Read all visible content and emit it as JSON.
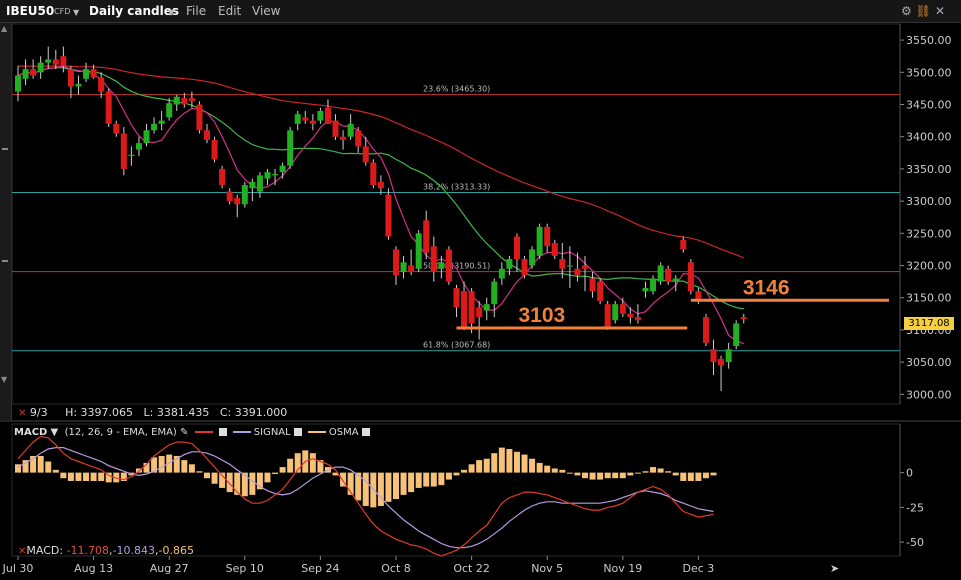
{
  "toolbar": {
    "symbol": "IBEU50",
    "instrument_type": "CFD",
    "period": "Daily candles",
    "menu_file": "File",
    "menu_edit": "Edit",
    "menu_view": "View"
  },
  "info_bar": {
    "date": "9/3",
    "high": "H: 3397.065",
    "low": "L: 3381.435",
    "close": "C: 3391.000"
  },
  "current_price": "3117.08",
  "annotations": {
    "support_level": "3103",
    "resistance_level": "3146"
  },
  "macd_legend": {
    "name": "MACD",
    "params": "(12, 26, 9 - EMA, EMA)",
    "signal": "SIGNAL",
    "osma": "OSMA"
  },
  "macd_values": {
    "label": "MACD:",
    "macd": "-11.708",
    "signal": "-10.843",
    "osma": "-0.865"
  },
  "colors": {
    "bull": "#22b022",
    "bear": "#dd1a1a",
    "ma_short": "#d0308a",
    "ma_mid": "#3cb84a",
    "ma_long": "#c8262a",
    "fib_line": "#2aa3a3",
    "fib_edge": "#c0362c",
    "annotation": "#f2803a",
    "macd_line": "#e03a2a",
    "signal_line": "#b69de0",
    "osma": "#f6c27a"
  },
  "chart_data": [
    {
      "type": "candlestick",
      "ylim": [
        2985,
        3575
      ],
      "y_ticks": [
        3000,
        3050,
        3100,
        3150,
        3200,
        3250,
        3300,
        3350,
        3400,
        3450,
        3500,
        3550
      ],
      "y_tick_labels": [
        "3000.00",
        "3050.00",
        "3100.00",
        "3150.00",
        "3200.00",
        "3250.00",
        "3300.00",
        "3350.00",
        "3400.00",
        "3450.00",
        "3500.00",
        "3550.00"
      ],
      "x_tick_labels": [
        "Jul 30",
        "Aug 13",
        "Aug 27",
        "Sep 10",
        "Sep 24",
        "Oct 8",
        "Oct 22",
        "Nov 5",
        "Nov 19",
        "Dec 3"
      ],
      "x_tick_index": [
        0,
        10,
        20,
        30,
        40,
        50,
        60,
        70,
        80,
        90
      ],
      "fib_levels": [
        {
          "label": "23.6% (3465.30)",
          "value": 3465.3
        },
        {
          "label": "38.2% (3313.33)",
          "value": 3313.33
        },
        {
          "label": "50.0% (3190.51)",
          "value": 3190.51
        },
        {
          "label": "61.8% (3067.68)",
          "value": 3067.68
        }
      ],
      "support": {
        "value": 3103,
        "from_index": 58,
        "to_index": 88
      },
      "resistance": {
        "value": 3146,
        "from_index": 89,
        "to_index": 103
      },
      "candles": [
        {
          "o": 3470,
          "h": 3510,
          "l": 3455,
          "c": 3495
        },
        {
          "o": 3490,
          "h": 3520,
          "l": 3480,
          "c": 3505
        },
        {
          "o": 3505,
          "h": 3520,
          "l": 3490,
          "c": 3495
        },
        {
          "o": 3500,
          "h": 3525,
          "l": 3490,
          "c": 3515
        },
        {
          "o": 3515,
          "h": 3540,
          "l": 3505,
          "c": 3520
        },
        {
          "o": 3520,
          "h": 3535,
          "l": 3505,
          "c": 3512
        },
        {
          "o": 3525,
          "h": 3540,
          "l": 3500,
          "c": 3510
        },
        {
          "o": 3505,
          "h": 3510,
          "l": 3460,
          "c": 3478
        },
        {
          "o": 3478,
          "h": 3495,
          "l": 3465,
          "c": 3482
        },
        {
          "o": 3490,
          "h": 3515,
          "l": 3485,
          "c": 3505
        },
        {
          "o": 3505,
          "h": 3512,
          "l": 3490,
          "c": 3492
        },
        {
          "o": 3492,
          "h": 3500,
          "l": 3460,
          "c": 3470
        },
        {
          "o": 3470,
          "h": 3475,
          "l": 3415,
          "c": 3420
        },
        {
          "o": 3420,
          "h": 3425,
          "l": 3400,
          "c": 3405
        },
        {
          "o": 3405,
          "h": 3415,
          "l": 3340,
          "c": 3350
        },
        {
          "o": 3370,
          "h": 3385,
          "l": 3355,
          "c": 3372
        },
        {
          "o": 3380,
          "h": 3400,
          "l": 3370,
          "c": 3390
        },
        {
          "o": 3390,
          "h": 3420,
          "l": 3385,
          "c": 3410
        },
        {
          "o": 3410,
          "h": 3430,
          "l": 3405,
          "c": 3420
        },
        {
          "o": 3420,
          "h": 3440,
          "l": 3410,
          "c": 3425
        },
        {
          "o": 3430,
          "h": 3460,
          "l": 3425,
          "c": 3452
        },
        {
          "o": 3450,
          "h": 3465,
          "l": 3440,
          "c": 3462
        },
        {
          "o": 3460,
          "h": 3468,
          "l": 3445,
          "c": 3450
        },
        {
          "o": 3460,
          "h": 3470,
          "l": 3445,
          "c": 3455
        },
        {
          "o": 3450,
          "h": 3455,
          "l": 3405,
          "c": 3410
        },
        {
          "o": 3410,
          "h": 3420,
          "l": 3390,
          "c": 3395
        },
        {
          "o": 3395,
          "h": 3400,
          "l": 3360,
          "c": 3365
        },
        {
          "o": 3350,
          "h": 3355,
          "l": 3320,
          "c": 3325
        },
        {
          "o": 3315,
          "h": 3320,
          "l": 3295,
          "c": 3300
        },
        {
          "o": 3305,
          "h": 3310,
          "l": 3275,
          "c": 3295
        },
        {
          "o": 3295,
          "h": 3330,
          "l": 3290,
          "c": 3325
        },
        {
          "o": 3320,
          "h": 3335,
          "l": 3300,
          "c": 3330
        },
        {
          "o": 3315,
          "h": 3345,
          "l": 3305,
          "c": 3340
        },
        {
          "o": 3335,
          "h": 3350,
          "l": 3325,
          "c": 3345
        },
        {
          "o": 3340,
          "h": 3350,
          "l": 3325,
          "c": 3342
        },
        {
          "o": 3345,
          "h": 3360,
          "l": 3335,
          "c": 3355
        },
        {
          "o": 3355,
          "h": 3415,
          "l": 3350,
          "c": 3410
        },
        {
          "o": 3420,
          "h": 3440,
          "l": 3410,
          "c": 3435
        },
        {
          "o": 3430,
          "h": 3440,
          "l": 3420,
          "c": 3425
        },
        {
          "o": 3425,
          "h": 3435,
          "l": 3410,
          "c": 3420
        },
        {
          "o": 3425,
          "h": 3445,
          "l": 3420,
          "c": 3440
        },
        {
          "o": 3445,
          "h": 3458,
          "l": 3420,
          "c": 3420
        },
        {
          "o": 3425,
          "h": 3435,
          "l": 3395,
          "c": 3400
        },
        {
          "o": 3400,
          "h": 3410,
          "l": 3380,
          "c": 3395
        },
        {
          "o": 3400,
          "h": 3435,
          "l": 3395,
          "c": 3420
        },
        {
          "o": 3410,
          "h": 3415,
          "l": 3375,
          "c": 3385
        },
        {
          "o": 3385,
          "h": 3400,
          "l": 3355,
          "c": 3360
        },
        {
          "o": 3360,
          "h": 3365,
          "l": 3320,
          "c": 3325
        },
        {
          "o": 3330,
          "h": 3340,
          "l": 3310,
          "c": 3320
        },
        {
          "o": 3310,
          "h": 3320,
          "l": 3240,
          "c": 3245
        },
        {
          "o": 3225,
          "h": 3230,
          "l": 3170,
          "c": 3185
        },
        {
          "o": 3190,
          "h": 3215,
          "l": 3180,
          "c": 3205
        },
        {
          "o": 3200,
          "h": 3225,
          "l": 3185,
          "c": 3190
        },
        {
          "o": 3195,
          "h": 3255,
          "l": 3190,
          "c": 3250
        },
        {
          "o": 3270,
          "h": 3285,
          "l": 3210,
          "c": 3220
        },
        {
          "o": 3230,
          "h": 3245,
          "l": 3175,
          "c": 3190
        },
        {
          "o": 3195,
          "h": 3215,
          "l": 3180,
          "c": 3205
        },
        {
          "o": 3225,
          "h": 3230,
          "l": 3170,
          "c": 3175
        },
        {
          "o": 3165,
          "h": 3170,
          "l": 3120,
          "c": 3135
        },
        {
          "o": 3160,
          "h": 3175,
          "l": 3100,
          "c": 3105
        },
        {
          "o": 3160,
          "h": 3165,
          "l": 3095,
          "c": 3110
        },
        {
          "o": 3135,
          "h": 3145,
          "l": 3085,
          "c": 3120
        },
        {
          "o": 3130,
          "h": 3150,
          "l": 3115,
          "c": 3140
        },
        {
          "o": 3140,
          "h": 3180,
          "l": 3120,
          "c": 3175
        },
        {
          "o": 3180,
          "h": 3205,
          "l": 3170,
          "c": 3195
        },
        {
          "o": 3195,
          "h": 3215,
          "l": 3185,
          "c": 3210
        },
        {
          "o": 3245,
          "h": 3250,
          "l": 3190,
          "c": 3210
        },
        {
          "o": 3210,
          "h": 3215,
          "l": 3180,
          "c": 3185
        },
        {
          "o": 3200,
          "h": 3230,
          "l": 3195,
          "c": 3225
        },
        {
          "o": 3215,
          "h": 3265,
          "l": 3210,
          "c": 3260
        },
        {
          "o": 3260,
          "h": 3265,
          "l": 3220,
          "c": 3230
        },
        {
          "o": 3235,
          "h": 3240,
          "l": 3210,
          "c": 3215
        },
        {
          "o": 3210,
          "h": 3235,
          "l": 3180,
          "c": 3195
        },
        {
          "o": 3200,
          "h": 3230,
          "l": 3165,
          "c": 3200
        },
        {
          "o": 3195,
          "h": 3220,
          "l": 3175,
          "c": 3185
        },
        {
          "o": 3200,
          "h": 3215,
          "l": 3160,
          "c": 3195
        },
        {
          "o": 3180,
          "h": 3190,
          "l": 3150,
          "c": 3160
        },
        {
          "o": 3175,
          "h": 3180,
          "l": 3140,
          "c": 3145
        },
        {
          "o": 3140,
          "h": 3145,
          "l": 3100,
          "c": 3105
        },
        {
          "o": 3115,
          "h": 3145,
          "l": 3110,
          "c": 3140
        },
        {
          "o": 3140,
          "h": 3150,
          "l": 3120,
          "c": 3125
        },
        {
          "o": 3125,
          "h": 3135,
          "l": 3110,
          "c": 3120
        },
        {
          "o": 3120,
          "h": 3140,
          "l": 3110,
          "c": 3115
        },
        {
          "o": 3160,
          "h": 3175,
          "l": 3150,
          "c": 3165
        },
        {
          "o": 3160,
          "h": 3185,
          "l": 3155,
          "c": 3180
        },
        {
          "o": 3175,
          "h": 3205,
          "l": 3170,
          "c": 3200
        },
        {
          "o": 3195,
          "h": 3200,
          "l": 3170,
          "c": 3175
        },
        {
          "o": 3175,
          "h": 3185,
          "l": 3160,
          "c": 3180
        },
        {
          "o": 3240,
          "h": 3245,
          "l": 3220,
          "c": 3225
        },
        {
          "o": 3205,
          "h": 3210,
          "l": 3155,
          "c": 3160
        },
        {
          "o": 3160,
          "h": 3165,
          "l": 3140,
          "c": 3145
        },
        {
          "o": 3120,
          "h": 3125,
          "l": 3075,
          "c": 3080
        },
        {
          "o": 3070,
          "h": 3085,
          "l": 3030,
          "c": 3050
        },
        {
          "o": 3055,
          "h": 3060,
          "l": 3005,
          "c": 3045
        },
        {
          "o": 3050,
          "h": 3080,
          "l": 3040,
          "c": 3070
        },
        {
          "o": 3075,
          "h": 3115,
          "l": 3070,
          "c": 3110
        },
        {
          "o": 3120,
          "h": 3125,
          "l": 3110,
          "c": 3117
        }
      ]
    },
    {
      "type": "macd",
      "ylim": [
        -60,
        35
      ],
      "y_ticks": [
        0,
        -25,
        -50
      ],
      "y_tick_labels": [
        "0",
        "-25",
        "-50"
      ],
      "x_tick_labels": [
        "Jul 30",
        "Aug 13",
        "Aug 27",
        "Sep 10",
        "Sep 24",
        "Oct 8",
        "Oct 22",
        "Nov 5",
        "Nov 19",
        "Dec 3"
      ],
      "series": [
        {
          "name": "MACD",
          "values": [
            10,
            16,
            22,
            26,
            25,
            20,
            14,
            10,
            8,
            6,
            4,
            2,
            -2,
            -4,
            -5,
            -3,
            1,
            6,
            12,
            16,
            20,
            22,
            22,
            21,
            16,
            10,
            4,
            -2,
            -8,
            -14,
            -19,
            -22,
            -22,
            -20,
            -16,
            -12,
            -5,
            2,
            8,
            10,
            8,
            6,
            2,
            -6,
            -14,
            -22,
            -30,
            -37,
            -42,
            -45,
            -48,
            -50,
            -52,
            -53,
            -55,
            -58,
            -60,
            -58,
            -56,
            -52,
            -47,
            -42,
            -38,
            -30,
            -22,
            -18,
            -16,
            -14,
            -14,
            -15,
            -16,
            -18,
            -20,
            -22,
            -24,
            -26,
            -27,
            -27,
            -25,
            -24,
            -22,
            -18,
            -14,
            -12,
            -10,
            -12,
            -16,
            -22,
            -28,
            -30,
            -32,
            -31,
            -30
          ]
        },
        {
          "name": "SIGNAL",
          "values": [
            4,
            7,
            10,
            14,
            17,
            18,
            18,
            16,
            14,
            12,
            10,
            8,
            5,
            3,
            1,
            -1,
            -2,
            -1,
            1,
            4,
            7,
            10,
            13,
            15,
            15,
            14,
            12,
            9,
            6,
            2,
            -2,
            -6,
            -10,
            -13,
            -15,
            -16,
            -15,
            -12,
            -8,
            -4,
            -1,
            2,
            4,
            4,
            2,
            -2,
            -6,
            -12,
            -18,
            -24,
            -29,
            -34,
            -38,
            -42,
            -45,
            -48,
            -51,
            -53,
            -54,
            -54,
            -53,
            -51,
            -48,
            -44,
            -40,
            -35,
            -31,
            -27,
            -24,
            -22,
            -21,
            -21,
            -22,
            -22,
            -22,
            -22,
            -22,
            -22,
            -21,
            -20,
            -18,
            -16,
            -14,
            -13,
            -14,
            -15,
            -17,
            -20,
            -22,
            -24,
            -26,
            -27,
            -28
          ]
        },
        {
          "name": "OSMA",
          "values": [
            6,
            9,
            12,
            12,
            8,
            2,
            -4,
            -6,
            -6,
            -6,
            -6,
            -6,
            -7,
            -7,
            -6,
            -2,
            3,
            7,
            11,
            12,
            13,
            12,
            9,
            6,
            1,
            -4,
            -8,
            -11,
            -14,
            -16,
            -17,
            -16,
            -12,
            -7,
            -1,
            4,
            10,
            14,
            16,
            14,
            9,
            4,
            -2,
            -10,
            -16,
            -20,
            -24,
            -25,
            -24,
            -21,
            -19,
            -16,
            -14,
            -11,
            -10,
            -10,
            -9,
            -5,
            -2,
            2,
            6,
            9,
            10,
            14,
            18,
            17,
            15,
            13,
            10,
            7,
            5,
            3,
            2,
            0,
            -2,
            -4,
            -5,
            -5,
            -4,
            -4,
            -4,
            -2,
            0,
            1,
            4,
            3,
            1,
            -2,
            -6,
            -6,
            -6,
            -4,
            -2
          ]
        }
      ]
    }
  ]
}
